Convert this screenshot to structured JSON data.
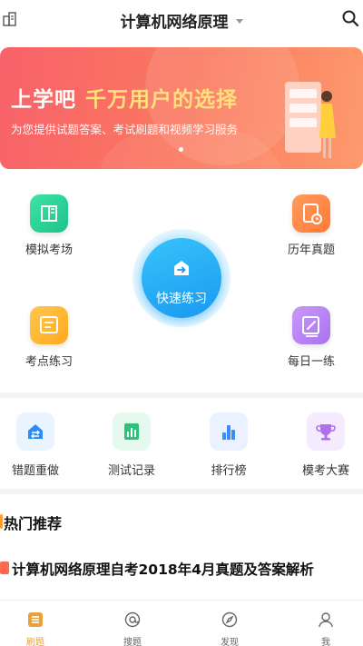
{
  "header": {
    "title": "计算机网络原理"
  },
  "banner": {
    "headline_part1": "上学吧",
    "headline_part2": "千万用户的选择",
    "subtitle": "为您提供试题答案、考试刷题和视频学习服务"
  },
  "functions": {
    "mock_exam": "模拟考场",
    "past_papers": "历年真题",
    "quick_practice": "快速练习",
    "topic_practice": "考点练习",
    "daily_practice": "每日一练"
  },
  "secondary": {
    "wrong_redo": "错题重做",
    "test_records": "测试记录",
    "ranking": "排行榜",
    "mock_contest": "模考大赛"
  },
  "hot": {
    "title": "热门推荐",
    "item_title": "计算机网络原理自考2018年4月真题及答案解析"
  },
  "tabbar": {
    "tabs": [
      {
        "label": "刷题",
        "icon": "list-icon",
        "active": true
      },
      {
        "label": "搜题",
        "icon": "search-at-icon",
        "active": false
      },
      {
        "label": "发现",
        "icon": "compass-icon",
        "active": false
      },
      {
        "label": "我",
        "icon": "person-icon",
        "active": false
      }
    ]
  },
  "colors": {
    "accent": "#e6a23c",
    "banner_start": "#f8626a",
    "banner_end": "#fd9a6d",
    "quick_blue": "#1b98f0"
  }
}
